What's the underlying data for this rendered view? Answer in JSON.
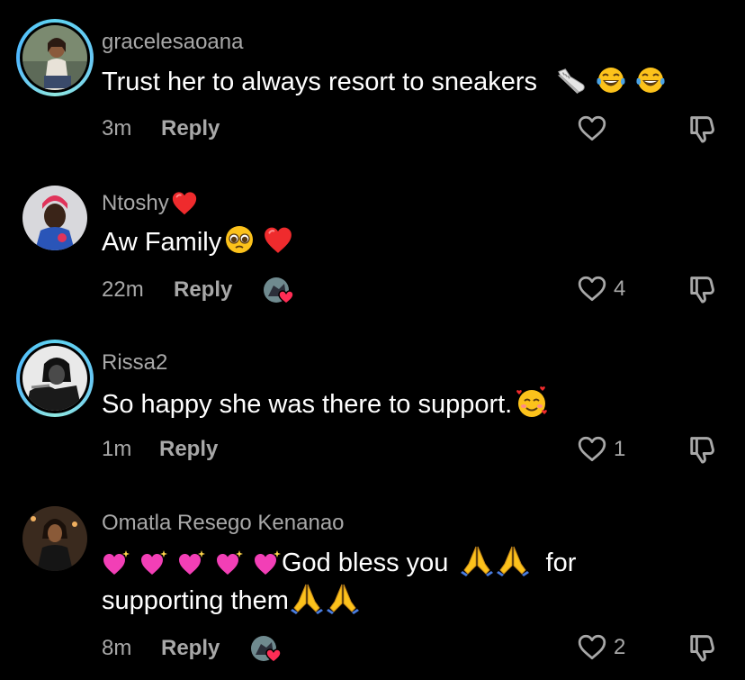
{
  "comments": [
    {
      "username": "gracelesaoana",
      "text": "Trust her to always resort to sneakers",
      "time": "3m",
      "reply_label": "Reply",
      "likes": "",
      "has_story_ring": true,
      "creator_liked": false,
      "trailing_emojis": [
        "sneaker-emoji",
        "tears-of-joy-emoji",
        "tears-of-joy-emoji"
      ]
    },
    {
      "username": "Ntoshy",
      "text": "Aw Family",
      "time": "22m",
      "reply_label": "Reply",
      "likes": "4",
      "has_story_ring": false,
      "creator_liked": true,
      "username_emoji": "red-heart-emoji",
      "trailing_emojis": [
        "pleading-face-emoji",
        "red-heart-emoji"
      ]
    },
    {
      "username": "Rissa2",
      "text": "So happy she was there to support.",
      "time": "1m",
      "reply_label": "Reply",
      "likes": "1",
      "has_story_ring": true,
      "creator_liked": false,
      "trailing_emojis": [
        "smiling-face-with-hearts-emoji"
      ]
    },
    {
      "username": "Omatla Resego Kenanao",
      "text_line1": "God bless you",
      "text_line1_end": "for",
      "text_line2": "supporting them",
      "time": "8m",
      "reply_label": "Reply",
      "likes": "2",
      "has_story_ring": false,
      "creator_liked": true,
      "leading_emojis": [
        "sparkling-heart-emoji",
        "sparkling-heart-emoji",
        "sparkling-heart-emoji",
        "sparkling-heart-emoji",
        "sparkling-heart-emoji"
      ],
      "mid_emojis": [
        "folded-hands-emoji",
        "folded-hands-emoji"
      ],
      "trailing_emojis": [
        "folded-hands-emoji",
        "folded-hands-emoji"
      ]
    }
  ],
  "colors": {
    "background": "#000000",
    "text": "#ffffff",
    "secondary": "#a8a8a8",
    "story_ring": "#5fd3f0",
    "heart": "#ff2d55"
  }
}
